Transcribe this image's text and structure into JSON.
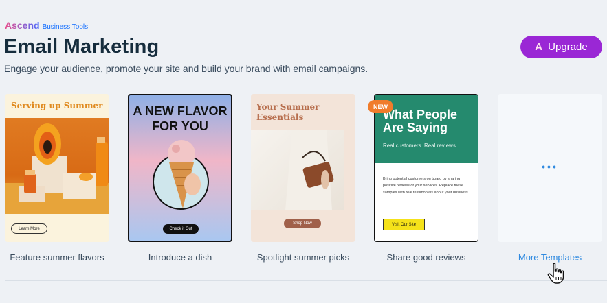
{
  "brand": {
    "name": "Ascend",
    "suffix": "Business Tools"
  },
  "header": {
    "title": "Email Marketing",
    "subtitle": "Engage your audience, promote your site and build your brand with email campaigns.",
    "upgrade_label": "Upgrade",
    "upgrade_icon": "ascend-a-icon"
  },
  "templates": [
    {
      "caption": "Feature summer flavors",
      "headline": "Serving up Summer",
      "button": "Learn More"
    },
    {
      "caption": "Introduce a dish",
      "headline_line1": "A NEW FLAVOR",
      "headline_line2": "FOR YOU",
      "button": "Check it Out"
    },
    {
      "caption": "Spotlight summer picks",
      "headline_line1": "Your Summer",
      "headline_line2": "Essentials",
      "button": "Shop Now"
    },
    {
      "caption": "Share good reviews",
      "badge": "NEW",
      "headline_line1": "What People",
      "headline_line2": "Are Saying",
      "subline": "Real customers. Real reviews.",
      "body": "Bring potential customers on board by sharing positive reviews of your services. Replace these samples with real testimonials about your business.",
      "button": "Visit Our Site"
    },
    {
      "caption": "More Templates",
      "more_icon": "ellipsis-icon"
    }
  ],
  "colors": {
    "background": "#eef1f5",
    "upgrade": "#9a27d5",
    "link": "#2f8ae0",
    "badge": "#f07c2b",
    "review_header": "#258a6e"
  }
}
